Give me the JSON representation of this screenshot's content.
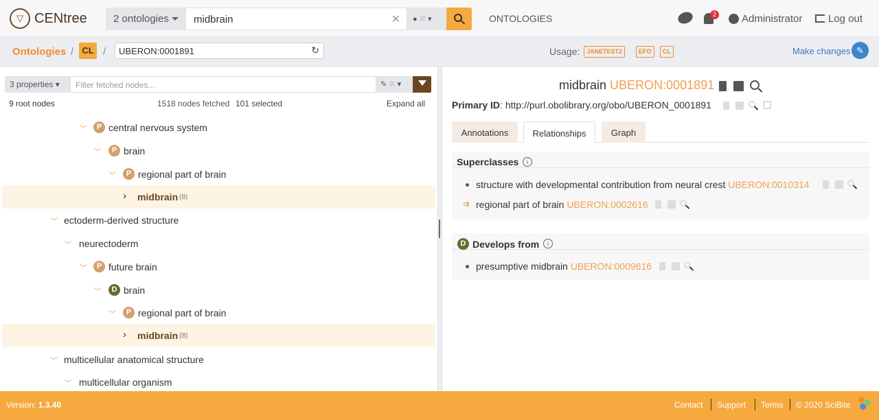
{
  "app": {
    "title": "CENtree"
  },
  "header": {
    "ontology_select": "2 ontologies",
    "search_value": "midbrain",
    "nav_ontologies": "ONTOLOGIES",
    "notification_count": "2",
    "user": "Administrator",
    "logout": "Log out"
  },
  "breadcrumb": {
    "ontologies": "Ontologies",
    "sep": "/",
    "current": "CL",
    "id_value": "UBERON:0001891",
    "usage_label": "Usage:",
    "usage": [
      "JANETEST2",
      "EFO",
      "CL"
    ],
    "make_changes": "Make changes"
  },
  "tree_panel": {
    "properties": "3 properties",
    "filter_placeholder": "Filter fetched nodes...",
    "root_nodes": "9 root nodes",
    "nodes_fetched": "1518 nodes fetched",
    "selected": "101 selected",
    "expand_all": "Expand all",
    "nodes": [
      {
        "label": "central nervous system",
        "badge": "P",
        "count": ""
      },
      {
        "label": "brain",
        "badge": "P",
        "count": ""
      },
      {
        "label": "regional part of brain",
        "badge": "P",
        "count": ""
      },
      {
        "label": "midbrain",
        "badge": "",
        "count": "(8)"
      },
      {
        "label": "ectoderm-derived structure",
        "badge": "",
        "count": ""
      },
      {
        "label": "neurectoderm",
        "badge": "",
        "count": ""
      },
      {
        "label": "future brain",
        "badge": "P",
        "count": ""
      },
      {
        "label": "brain",
        "badge": "D",
        "count": ""
      },
      {
        "label": "regional part of brain",
        "badge": "P",
        "count": ""
      },
      {
        "label": "midbrain",
        "badge": "",
        "count": "(8)"
      },
      {
        "label": "multicellular anatomical structure",
        "badge": "",
        "count": ""
      },
      {
        "label": "multicellular organism",
        "badge": "",
        "count": ""
      }
    ]
  },
  "detail": {
    "term_label": "midbrain",
    "term_id": "UBERON:0001891",
    "primary_id_label": "Primary ID",
    "primary_id_value": ": http://purl.obolibrary.org/obo/UBERON_0001891",
    "tabs": [
      "Annotations",
      "Relationships",
      "Graph"
    ],
    "superclasses_title": "Superclasses",
    "superclasses": [
      {
        "label": "structure with developmental contribution from neural crest",
        "id": "UBERON:0010314"
      },
      {
        "label": "regional part of brain",
        "id": "UBERON:0002616"
      }
    ],
    "develops_title": "Develops from",
    "develops_badge": "D",
    "develops": [
      {
        "label": "presumptive midbrain",
        "id": "UBERON:0009616"
      }
    ]
  },
  "footer": {
    "version_label": "Version: ",
    "version": "1.3.40",
    "links": [
      "Contact",
      "Support",
      "Terms"
    ],
    "copyright": "© 2020 SciBite"
  },
  "colors": {
    "accent": "#f5a93e",
    "link_orange": "#f0a050",
    "brand_brown": "#6b4720"
  }
}
